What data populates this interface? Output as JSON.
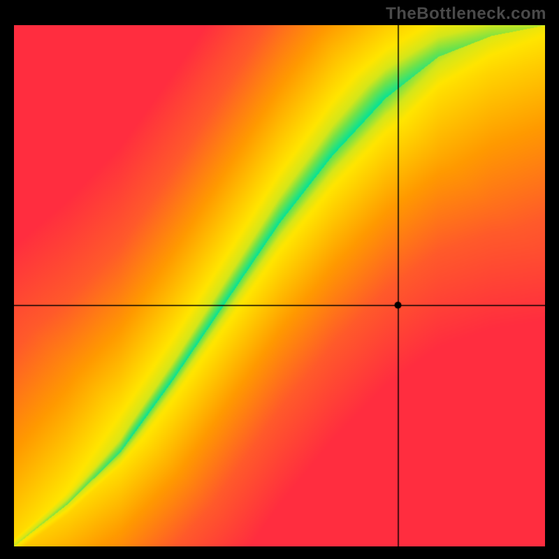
{
  "watermark": "TheBottleneck.com",
  "chart_data": {
    "type": "heatmap",
    "title": "",
    "xlabel": "",
    "ylabel": "",
    "xlim": [
      0,
      1
    ],
    "ylim": [
      0,
      1
    ],
    "grid": false,
    "legend": false,
    "crosshair": {
      "x": 0.724,
      "y": 0.462
    },
    "marker": {
      "x": 0.724,
      "y": 0.462,
      "radius": 5,
      "color": "#000000"
    },
    "optimal_curve": {
      "description": "Diagonal performance-match ridge; green = balanced, shifting through yellow/orange to red away from ridge.",
      "points_xy": [
        [
          0.0,
          0.0
        ],
        [
          0.1,
          0.08
        ],
        [
          0.2,
          0.18
        ],
        [
          0.3,
          0.32
        ],
        [
          0.4,
          0.47
        ],
        [
          0.5,
          0.62
        ],
        [
          0.6,
          0.75
        ],
        [
          0.7,
          0.86
        ],
        [
          0.8,
          0.94
        ],
        [
          0.9,
          0.98
        ],
        [
          1.0,
          1.0
        ]
      ],
      "band_halfwidth_start": 0.015,
      "band_halfwidth_end": 0.075
    },
    "color_stops": [
      {
        "t": 0.0,
        "color": "#00e29a"
      },
      {
        "t": 0.07,
        "color": "#6fe24a"
      },
      {
        "t": 0.13,
        "color": "#d4e61a"
      },
      {
        "t": 0.2,
        "color": "#ffe500"
      },
      {
        "t": 0.45,
        "color": "#ff9a00"
      },
      {
        "t": 0.7,
        "color": "#ff5a2a"
      },
      {
        "t": 1.0,
        "color": "#ff2d3f"
      }
    ]
  }
}
